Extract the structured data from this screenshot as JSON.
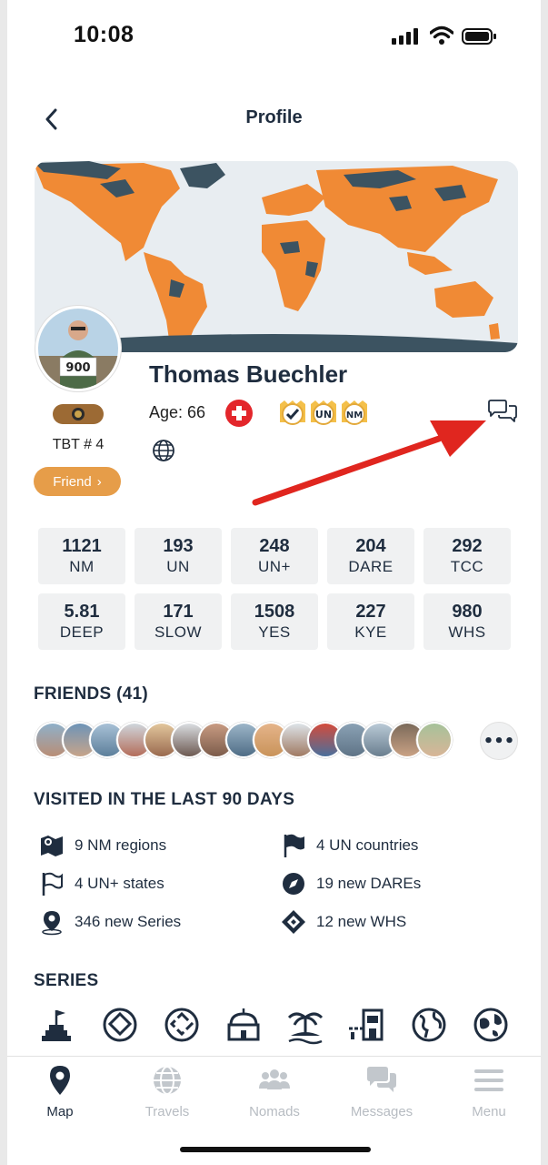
{
  "status_bar": {
    "time": "10:08"
  },
  "header": {
    "title": "Profile"
  },
  "profile": {
    "name": "Thomas Buechler",
    "age_label": "Age: 66",
    "tbt_label": "TBT # 4",
    "friend_button": "Friend",
    "badges": [
      "UN",
      "NM"
    ]
  },
  "stats": [
    {
      "value": "1121",
      "label": "NM"
    },
    {
      "value": "193",
      "label": "UN"
    },
    {
      "value": "248",
      "label": "UN+"
    },
    {
      "value": "204",
      "label": "DARE"
    },
    {
      "value": "292",
      "label": "TCC"
    },
    {
      "value": "5.81",
      "label": "DEEP"
    },
    {
      "value": "171",
      "label": "SLOW"
    },
    {
      "value": "1508",
      "label": "YES"
    },
    {
      "value": "227",
      "label": "KYE"
    },
    {
      "value": "980",
      "label": "WHS"
    }
  ],
  "friends": {
    "title": "FRIENDS (41)",
    "more": "•••"
  },
  "visited": {
    "title": "VISITED IN THE LAST 90 DAYS",
    "items": [
      {
        "text": "9 NM regions",
        "icon": "map-region-icon"
      },
      {
        "text": "4 UN countries",
        "icon": "flag-icon"
      },
      {
        "text": "4 UN+ states",
        "icon": "flag-outline-icon"
      },
      {
        "text": "19 new DAREs",
        "icon": "compass-icon"
      },
      {
        "text": "346 new Series",
        "icon": "location-pin-icon"
      },
      {
        "text": "12 new WHS",
        "icon": "whs-diamond-icon"
      }
    ]
  },
  "series": {
    "title": "SERIES"
  },
  "tabbar": {
    "items": [
      {
        "label": "Map",
        "icon": "map-pin-icon"
      },
      {
        "label": "Travels",
        "icon": "globe-icon"
      },
      {
        "label": "Nomads",
        "icon": "people-icon"
      },
      {
        "label": "Messages",
        "icon": "messages-icon"
      },
      {
        "label": "Menu",
        "icon": "hamburger-icon"
      }
    ]
  },
  "colors": {
    "accent_orange": "#e69d49",
    "map_visited": "#f08a35",
    "map_unvisited": "#3c5361",
    "text_dark": "#1f2d3f"
  }
}
